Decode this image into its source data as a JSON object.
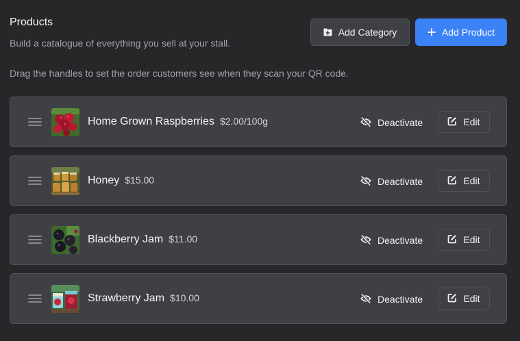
{
  "header": {
    "title": "Products",
    "subtitle": "Build a catalogue of everything you sell at your stall.",
    "hint": "Drag the handles to set the order customers see when they scan your QR code."
  },
  "actions": {
    "add_category_label": "Add Category",
    "add_product_label": "Add Product"
  },
  "row_actions": {
    "deactivate_label": "Deactivate",
    "edit_label": "Edit"
  },
  "products": [
    {
      "name": "Home Grown Raspberries",
      "price": "$2.00/100g"
    },
    {
      "name": "Honey",
      "price": "$15.00"
    },
    {
      "name": "Blackberry Jam",
      "price": "$11.00"
    },
    {
      "name": "Strawberry Jam",
      "price": "$10.00"
    }
  ],
  "colors": {
    "background": "#27272a",
    "card": "#3f3f46",
    "border": "#52525b",
    "accent": "#3b82f6"
  }
}
